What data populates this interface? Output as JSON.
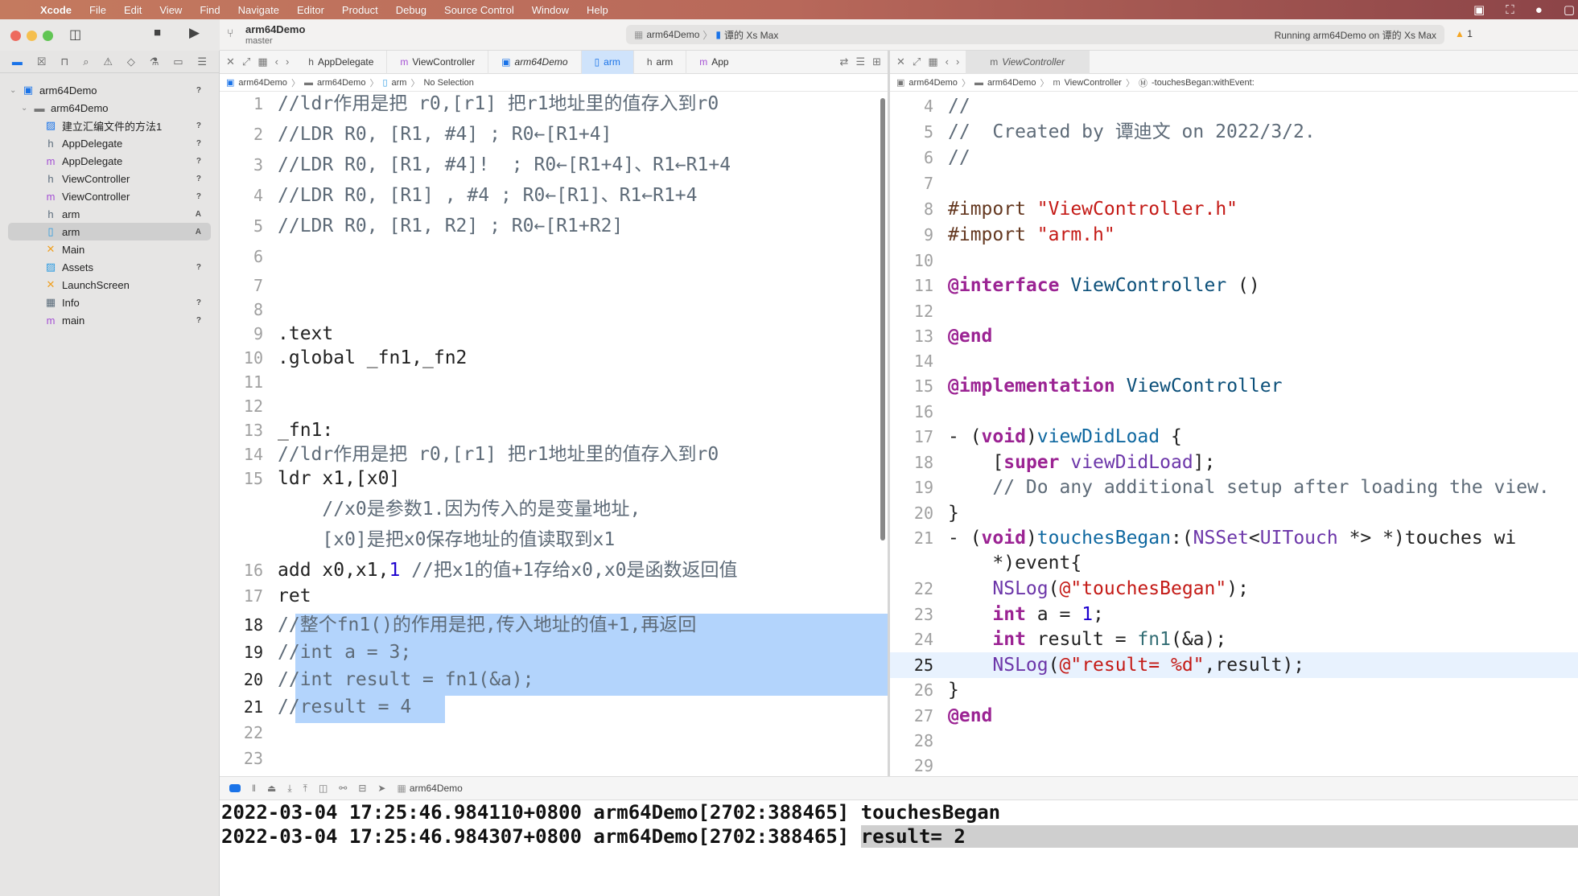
{
  "menubar": {
    "items": [
      "Xcode",
      "File",
      "Edit",
      "View",
      "Find",
      "Navigate",
      "Editor",
      "Product",
      "Debug",
      "Source Control",
      "Window",
      "Help"
    ],
    "status_icons": [
      "wps-icon",
      "screenshot-icon",
      "wechat-icon",
      "window-icon"
    ]
  },
  "toolbar": {
    "project_name": "arm64Demo",
    "branch": "master",
    "scheme": "arm64Demo",
    "device": "谭的 Xs Max",
    "status": "Running arm64Demo on 谭的 Xs Max",
    "warning_count": "1"
  },
  "sidebar": {
    "items": [
      {
        "label": "arm64Demo",
        "badge": "?",
        "icon": "project-icon"
      },
      {
        "label": "arm64Demo",
        "badge": "",
        "icon": "folder-icon"
      },
      {
        "label": "建立汇编文件的方法1",
        "badge": "?",
        "icon": "image-icon"
      },
      {
        "label": "AppDelegate",
        "badge": "?",
        "icon": "h-file-icon"
      },
      {
        "label": "AppDelegate",
        "badge": "?",
        "icon": "m-file-icon"
      },
      {
        "label": "ViewController",
        "badge": "?",
        "icon": "h-file-icon"
      },
      {
        "label": "ViewController",
        "badge": "?",
        "icon": "m-file-icon"
      },
      {
        "label": "arm",
        "badge": "A",
        "icon": "h-file-icon"
      },
      {
        "label": "arm",
        "badge": "A",
        "icon": "asm-file-icon"
      },
      {
        "label": "Main",
        "badge": "",
        "icon": "storyboard-icon"
      },
      {
        "label": "Assets",
        "badge": "?",
        "icon": "assets-icon"
      },
      {
        "label": "LaunchScreen",
        "badge": "",
        "icon": "storyboard-icon"
      },
      {
        "label": "Info",
        "badge": "?",
        "icon": "plist-icon"
      },
      {
        "label": "main",
        "badge": "?",
        "icon": "m-file-icon"
      }
    ]
  },
  "left_editor": {
    "tabs": [
      "AppDelegate",
      "ViewController",
      "arm64Demo",
      "arm",
      "arm",
      "App"
    ],
    "breadcrumb": [
      "arm64Demo",
      "arm64Demo",
      "arm",
      "No Selection"
    ],
    "lines": [
      {
        "n": "1",
        "t": "//ldr作用是把 r0,[r1] 把r1地址里的值存入到r0"
      },
      {
        "n": "2",
        "t": "//LDR R0, [R1, #4] ; R0←[R1+4]"
      },
      {
        "n": "3",
        "t": "//LDR R0, [R1, #4]!  ; R0←[R1+4]、R1←R1+4"
      },
      {
        "n": "4",
        "t": "//LDR R0, [R1] , #4 ; R0←[R1]、R1←R1+4"
      },
      {
        "n": "5",
        "t": "//LDR R0, [R1, R2] ; R0←[R1+R2]"
      },
      {
        "n": "6",
        "t": ""
      },
      {
        "n": "7",
        "t": ""
      },
      {
        "n": "8",
        "t": ""
      },
      {
        "n": "9",
        "t": ".text"
      },
      {
        "n": "10",
        "t": ".global _fn1,_fn2"
      },
      {
        "n": "11",
        "t": ""
      },
      {
        "n": "12",
        "t": ""
      },
      {
        "n": "13",
        "t": "_fn1:"
      },
      {
        "n": "14",
        "t": "//ldr作用是把 r0,[r1] 把r1地址里的值存入到r0"
      },
      {
        "n": "15",
        "t": "ldr x1,[x0]"
      },
      {
        "n": "",
        "t": "    //x0是参数1.因为传入的是变量地址,"
      },
      {
        "n": "",
        "t": "    [x0]是把x0保存地址的值读取到x1"
      },
      {
        "n": "16",
        "t1": "add x0,x1,",
        "t2": "1",
        "t3": " //把x1的值+1存给x0,x0是函数返回值"
      },
      {
        "n": "17",
        "t": "ret"
      },
      {
        "n": "18",
        "t": "//整个fn1()的作用是把,传入地址的值+1,再返回"
      },
      {
        "n": "19",
        "t": "//int a = 3;"
      },
      {
        "n": "20",
        "t": "//int result = fn1(&a);"
      },
      {
        "n": "21",
        "t": "//result = 4"
      },
      {
        "n": "22",
        "t": ""
      },
      {
        "n": "23",
        "t": ""
      }
    ]
  },
  "right_editor": {
    "tab": "ViewController",
    "breadcrumb": [
      "arm64Demo",
      "arm64Demo",
      "ViewController",
      "-touchesBegan:withEvent:"
    ],
    "lines": {
      "l4": "//",
      "l5": "//  Created by 谭迪文 on 2022/3/2.",
      "l6": "//",
      "l8a": "#import ",
      "l8b": "\"ViewController.h\"",
      "l9a": "#import ",
      "l9b": "\"arm.h\"",
      "l11a": "@interface",
      "l11b": " ViewController",
      "l11c": " ()",
      "l13": "@end",
      "l15a": "@implementation",
      "l15b": " ViewController",
      "l17a": "- (",
      "l17b": "void",
      "l17c": ")",
      "l17d": "viewDidLoad",
      "l17e": " {",
      "l18a": "    [",
      "l18b": "super",
      "l18c": " viewDidLoad",
      "l18d": "];",
      "l19": "    // Do any additional setup after loading the view.",
      "l20": "}",
      "l21a": "- (",
      "l21b": "void",
      "l21c": ")",
      "l21d": "touchesBegan",
      "l21e": ":(",
      "l21f": "NSSet",
      "l21g": "<",
      "l21h": "UITouch",
      "l21i": " *> *)touches wi",
      "l21w": "    *)event{",
      "l22a": "    ",
      "l22b": "NSLog",
      "l22c": "(",
      "l22d": "@\"touchesBegan\"",
      "l22e": ");",
      "l23a": "    ",
      "l23b": "int",
      "l23c": " a = ",
      "l23d": "1",
      "l23e": ";",
      "l24a": "    ",
      "l24b": "int",
      "l24c": " result = ",
      "l24d": "fn1",
      "l24e": "(&a);",
      "l25a": "    ",
      "l25b": "NSLog",
      "l25c": "(",
      "l25d": "@\"result= %d\"",
      "l25e": ",result);",
      "l26": "}",
      "l27": "@end"
    },
    "numbers": [
      "4",
      "5",
      "6",
      "7",
      "8",
      "9",
      "10",
      "11",
      "12",
      "13",
      "14",
      "15",
      "16",
      "17",
      "18",
      "19",
      "20",
      "21",
      "22",
      "23",
      "24",
      "25",
      "26",
      "27",
      "28",
      "29"
    ]
  },
  "debug": {
    "process": "arm64Demo"
  },
  "console": {
    "lines": [
      {
        "prefix": "2022-03-04 17:25:46.984110+0800 arm64Demo[2702:388465] ",
        "msg": "touchesBegan"
      },
      {
        "prefix": "2022-03-04 17:25:46.984307+0800 arm64Demo[2702:388465] ",
        "msg": "result= 2"
      }
    ]
  }
}
